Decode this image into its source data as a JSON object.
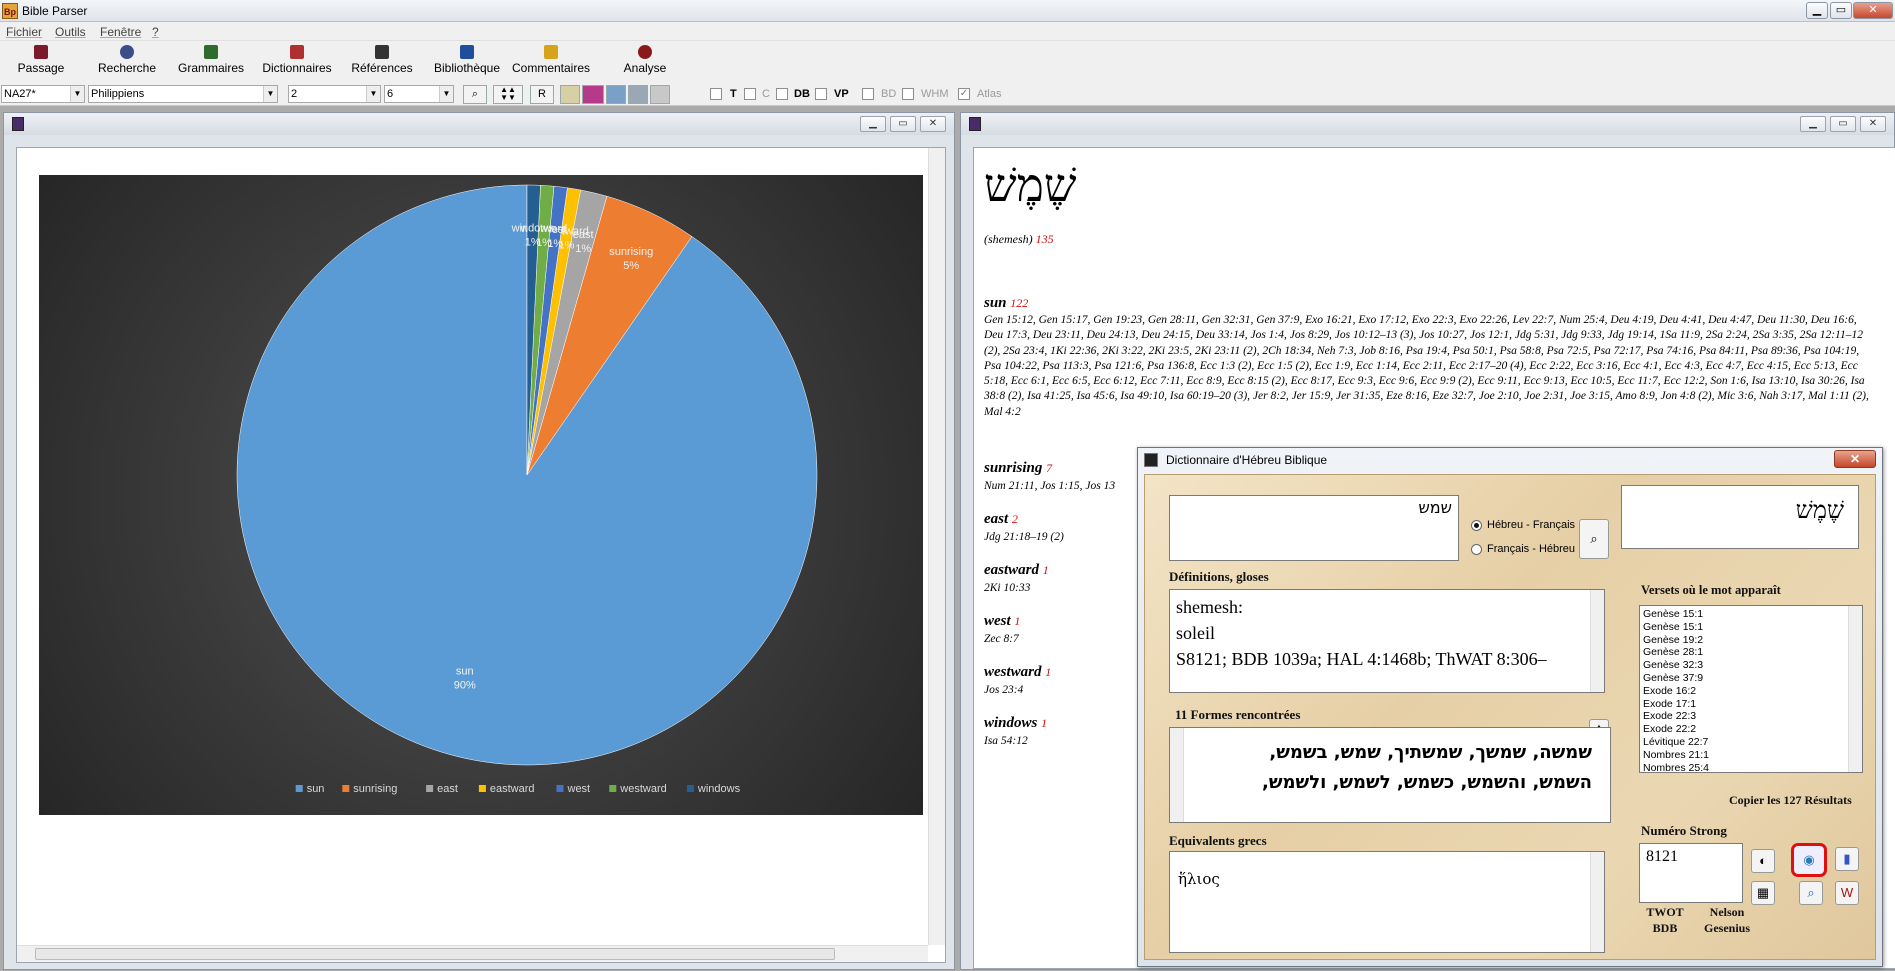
{
  "app": {
    "title": "Bible Parser",
    "icon": "Bp"
  },
  "menu": [
    "Fichier",
    "Outils",
    "Fenêtre",
    "?"
  ],
  "toolbar": {
    "buttons": [
      {
        "label": "Passage",
        "color": "#7a1a2a"
      },
      {
        "label": "Recherche",
        "color": "#3a4e8a"
      },
      {
        "label": "Grammaires",
        "color": "#2e6b2e"
      },
      {
        "label": "Dictionnaires",
        "color": "#b03030"
      },
      {
        "label": "Références",
        "color": "#333333"
      },
      {
        "label": "Bibliothèque",
        "color": "#1f4f9a"
      },
      {
        "label": "Commentaires",
        "color": "#d6a41a"
      },
      {
        "label": "Analyse",
        "color": "#8a1a1a"
      }
    ]
  },
  "selectors": {
    "version": "NA27*",
    "book": "Philippiens",
    "chapter": "2",
    "verse": "6",
    "r_button": "R",
    "checks": [
      {
        "label": "T",
        "dim": false
      },
      {
        "label": "C",
        "dim": true
      },
      {
        "label": "DB",
        "dim": false
      },
      {
        "label": "VP",
        "dim": false
      },
      {
        "label": "BD",
        "dim": true
      },
      {
        "label": "WHM",
        "dim": true
      },
      {
        "label": "Atlas",
        "dim": true,
        "checked": true
      }
    ]
  },
  "chart_data": {
    "type": "pie",
    "categories": [
      "sun",
      "sunrising",
      "east",
      "eastward",
      "west",
      "westward",
      "windows"
    ],
    "values": [
      122,
      7,
      2,
      1,
      1,
      1,
      1
    ],
    "data_labels": [
      "90%",
      "5%",
      "1%",
      "1%",
      "1%",
      "1%",
      "1%"
    ],
    "colors": [
      "#5b9bd5",
      "#ed7d31",
      "#a5a5a5",
      "#ffc000",
      "#4472c4",
      "#70ad47",
      "#255e91"
    ],
    "legend": "bottom"
  },
  "entry": {
    "hebrew": "שֶׁמֶשׁ",
    "translit": "(shemesh)",
    "count": "135",
    "words": [
      {
        "word": "sun",
        "count": "122"
      },
      {
        "word": "sunrising",
        "count": "7",
        "refs": "Num 21:11, Jos 1:15, Jos 13"
      },
      {
        "word": "east",
        "count": "2",
        "refs": "Jdg 21:18–19 (2)"
      },
      {
        "word": "eastward",
        "count": "1",
        "refs": "2Ki 10:33"
      },
      {
        "word": "west",
        "count": "1",
        "refs": "Zec 8:7"
      },
      {
        "word": "westward",
        "count": "1",
        "refs": "Jos 23:4"
      },
      {
        "word": "windows",
        "count": "1",
        "refs": "Isa 54:12"
      }
    ],
    "sun_refs": "Gen 15:12, Gen 15:17, Gen 19:23, Gen 28:11, Gen 32:31, Gen 37:9, Exo 16:21, Exo 17:12, Exo 22:3, Exo 22:26, Lev 22:7, Num 25:4, Deu 4:19, Deu 4:41, Deu 4:47, Deu 11:30, Deu 16:6, Deu 17:3, Deu 23:11, Deu 24:13, Deu 24:15, Deu 33:14, Jos 1:4, Jos 8:29, Jos 10:12–13 (3), Jos 10:27, Jos 12:1, Jdg 5:31, Jdg 9:33, Jdg 19:14, 1Sa 11:9, 2Sa 2:24, 2Sa 3:35, 2Sa 12:11–12 (2), 2Sa 23:4, 1Ki 22:36, 2Ki 3:22, 2Ki 23:5, 2Ki 23:11 (2), 2Ch 18:34, Neh 7:3, Job 8:16, Psa 19:4, Psa 50:1, Psa 58:8, Psa 72:5, Psa 72:17, Psa 74:16, Psa 84:11, Psa 89:36, Psa 104:19, Psa 104:22, Psa 113:3, Psa 121:6, Psa 136:8, Ecc 1:3 (2), Ecc 1:5 (2), Ecc 1:9, Ecc 1:14, Ecc 2:11, Ecc 2:17–20 (4), Ecc 2:22, Ecc 3:16, Ecc 4:1, Ecc 4:3, Ecc 4:7, Ecc 4:15, Ecc 5:13, Ecc 5:18, Ecc 6:1, Ecc 6:5, Ecc 6:12, Ecc 7:11, Ecc 8:9, Ecc 8:15 (2), Ecc 8:17, Ecc 9:3, Ecc 9:6, Ecc 9:9 (2), Ecc 9:11, Ecc 9:13, Ecc 10:5, Ecc 11:7, Ecc 12:2, Son 1:6, Isa 13:10, Isa 30:26, Isa 38:8 (2), Isa 41:25, Isa 45:6, Isa 49:10, Isa 60:19–20 (3), Jer 8:2, Jer 15:9, Jer 31:35, Eze 8:16, Eze 32:7, Joe 2:10, Joe 2:31, Joe 3:15, Amo 8:9, Jon 4:8 (2), Mic 3:6, Nah 3:17, Mal 1:11 (2), Mal 4:2"
  },
  "dict": {
    "title": "Dictionnaire d'Hébreu Biblique",
    "search_value": "שמש",
    "radio_hf": "Hébreu - Français",
    "radio_fh": "Français - Hébreu",
    "display_word": "שֶׁמֶשׁ",
    "definitions_label": "Définitions, gloses",
    "definitions": [
      "shemesh:",
      "soleil",
      "S8121; BDB 1039a; HAL 4:1468b; ThWAT 8:306–"
    ],
    "forms_label": "11 Formes rencontrées",
    "forms_line1": "שמשה, שמשך, שמשתיך, שמש, בשמש,",
    "forms_line2": "השמש, והשמש, כשמש, לשמש, ולשמש,",
    "greek_label": "Equivalents grecs",
    "greek_value": "ἥλιος",
    "verses_label": "Versets où le mot apparaît",
    "verses": [
      "Genèse 15:1",
      "Genèse 15:1",
      "Genèse 19:2",
      "Genèse 28:1",
      "Genèse 32:3",
      "Genèse 37:9",
      "Exode 16:2",
      "Exode 17:1",
      "Exode 22:3",
      "Exode 22:2",
      "Lévitique 22:7",
      "Nombres 21:1",
      "Nombres 25:4"
    ],
    "copy_label": "Copier les 127 Résultats",
    "strong_label": "Numéro Strong",
    "strong_value": "8121",
    "twot": "TWOT",
    "bdb": "BDB",
    "nelson": "Nelson",
    "gesenius": "Gesenius"
  }
}
